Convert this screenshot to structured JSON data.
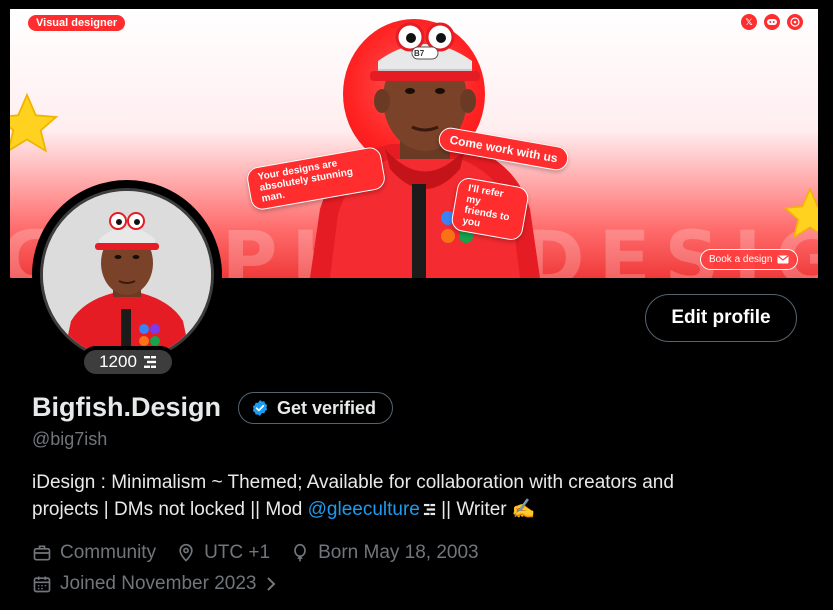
{
  "banner": {
    "tag": "Visual designer",
    "big_word": "GRAPHIC DESIGN",
    "bubble_1": "Your designs are absolutely stunning man.",
    "bubble_2": "Come work with us",
    "bubble_3": "I'll refer my friends to you",
    "book_button": "Book a design",
    "cap_text": "B7",
    "social_icons": [
      "x-icon",
      "discord-icon",
      "whatsapp-icon"
    ]
  },
  "avatar": {
    "badge_count": "1200"
  },
  "actions": {
    "edit_profile": "Edit profile",
    "get_verified": "Get verified"
  },
  "profile": {
    "display_name": "Bigfish.Design",
    "handle": "@big7ish",
    "bio_line1": "iDesign : Minimalism ~ Themed; Available for collaboration with creators and",
    "bio_line2_a": "projects | DMs not locked || Mod ",
    "bio_mention": "@gleeculture",
    "bio_line2_b": " || Writer ✍️",
    "category": "Community",
    "location": "UTC +1",
    "birthday": "Born May 18, 2003",
    "joined": "Joined November 2023"
  },
  "colors": {
    "accent": "#1d9bf0",
    "banner_red": "#ff2d2d",
    "muted": "#71767b",
    "border": "#536471"
  }
}
